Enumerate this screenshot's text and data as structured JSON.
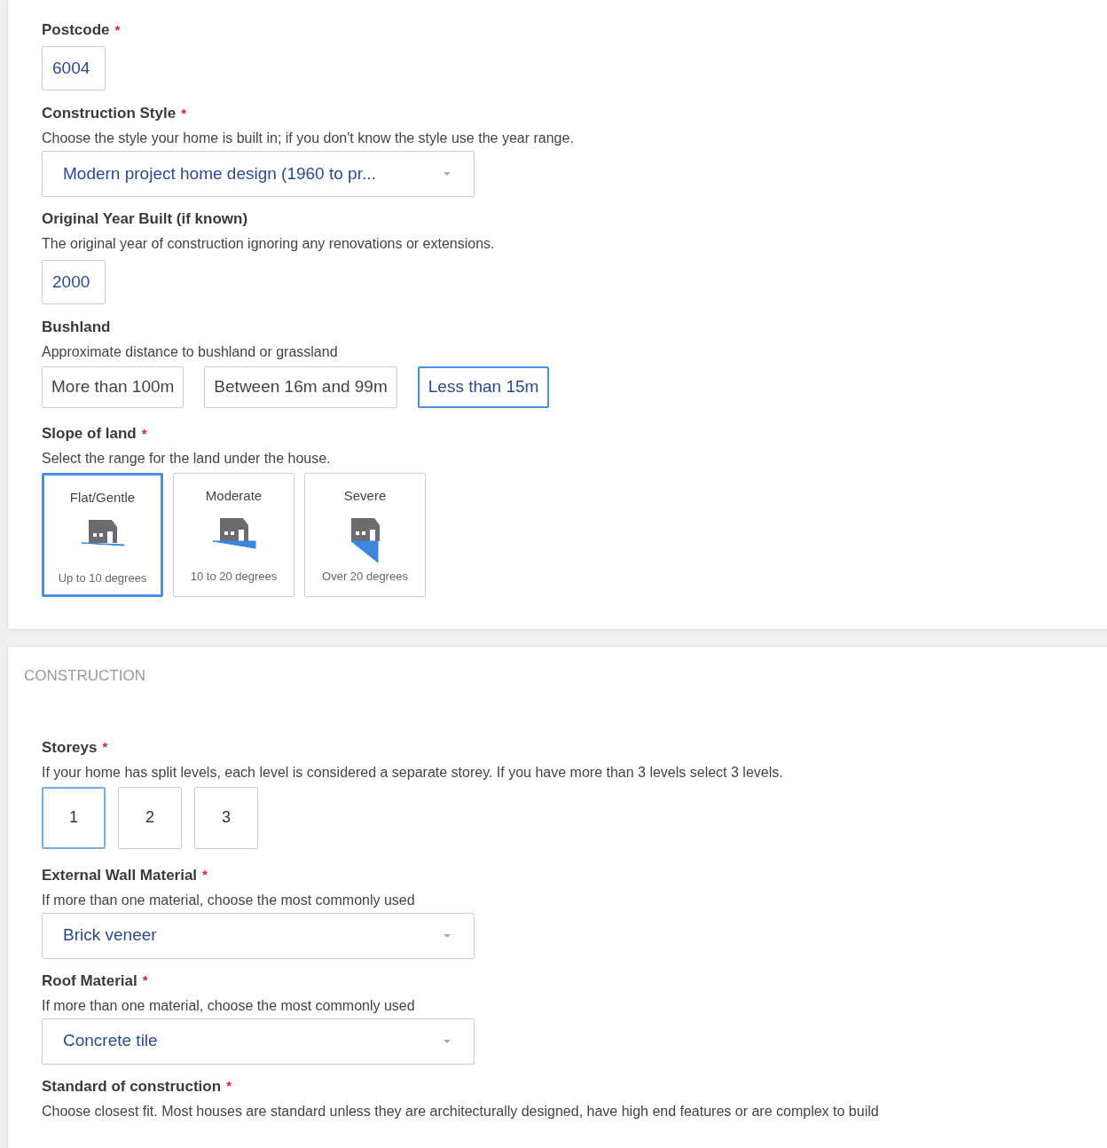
{
  "sections": [
    {
      "fields": [
        {
          "kind": "text",
          "label": "Postcode",
          "required_mark": "*",
          "value": "6004"
        },
        {
          "kind": "select",
          "label": "Construction Style",
          "required_mark": "*",
          "description": "Choose the style your home is built in; if you don't know the style use the year range.",
          "value": "Modern project home design (1960 to pr..."
        },
        {
          "kind": "text",
          "label": "Original Year Built (if known)",
          "description": "The original year of construction ignoring any renovations or extensions.",
          "value": "2000"
        },
        {
          "kind": "choices",
          "label": "Bushland",
          "description": "Approximate distance to bushland or grassland",
          "options": [
            {
              "label": "More than 100m",
              "selected": false
            },
            {
              "label": "Between 16m and 99m",
              "selected": false
            },
            {
              "label": "Less than 15m",
              "selected": true
            }
          ]
        },
        {
          "kind": "slope",
          "label": "Slope of land",
          "required_mark": "*",
          "description": "Select the range for the land under the house.",
          "options": [
            {
              "kind": "flat",
              "label": "Flat/Gentle",
              "caption": "Up to 10 degrees",
              "selected": true
            },
            {
              "kind": "moderate",
              "label": "Moderate",
              "caption": "10 to 20 degrees",
              "selected": false
            },
            {
              "kind": "severe",
              "label": "Severe",
              "caption": "Over 20 degrees",
              "selected": false
            }
          ]
        }
      ]
    },
    {
      "title": "CONSTRUCTION",
      "fields": [
        {
          "kind": "tiles",
          "label": "Storeys",
          "required_mark": "*",
          "description": "If your home has split levels, each level is considered a separate storey. If you have more than 3 levels select 3 levels.",
          "options": [
            {
              "label": "1",
              "selected": true
            },
            {
              "label": "2",
              "selected": false
            },
            {
              "label": "3",
              "selected": false
            }
          ]
        },
        {
          "kind": "select",
          "label": "External Wall Material",
          "required_mark": "*",
          "description": "If more than one material, choose the most commonly used",
          "value": "Brick veneer"
        },
        {
          "kind": "select",
          "label": "Roof Material",
          "required_mark": "*",
          "description": "If more than one material, choose the most commonly used",
          "value": "Concrete tile"
        },
        {
          "kind": "info",
          "label": "Standard of construction",
          "required_mark": "*",
          "description": "Choose closest fit. Most houses are standard unless they are architecturally designed, have high end features or are complex to build"
        }
      ]
    }
  ]
}
